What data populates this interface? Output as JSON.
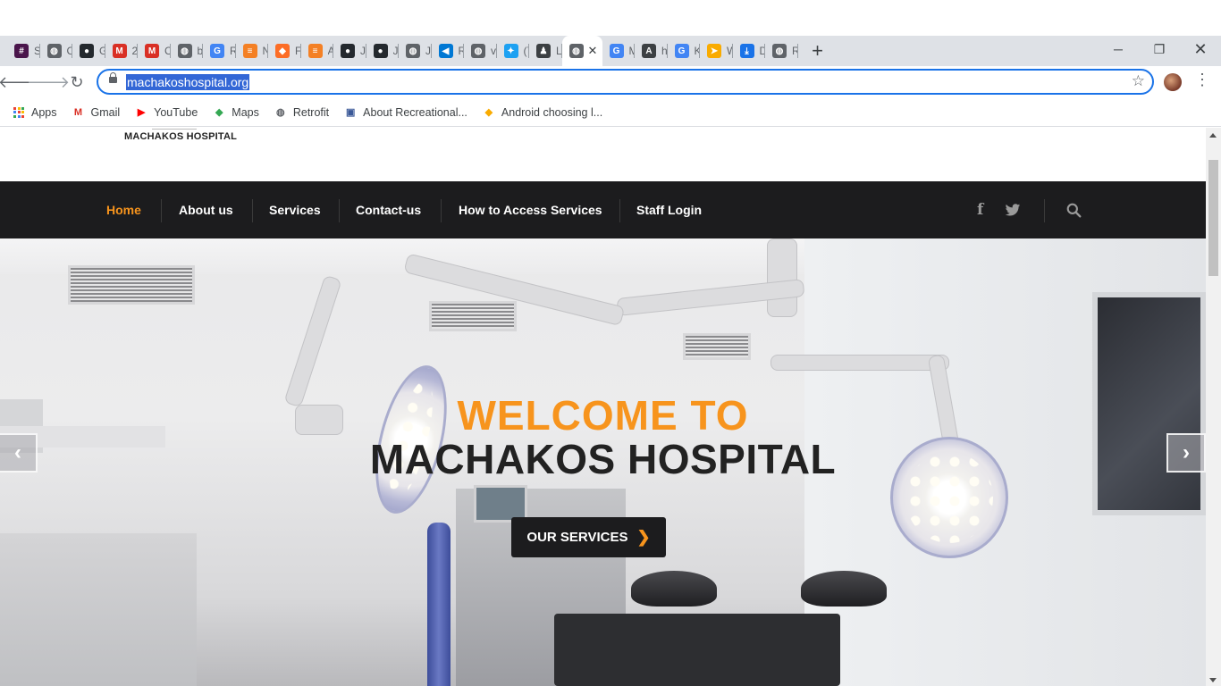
{
  "browser": {
    "tabs": [
      {
        "label": "Sl",
        "color": "#4a154b",
        "glyph": "#"
      },
      {
        "label": "C",
        "color": "#5f6368",
        "glyph": "◍"
      },
      {
        "label": "G",
        "color": "#24292e",
        "glyph": "●"
      },
      {
        "label": "2",
        "color": "#d93025",
        "glyph": "M"
      },
      {
        "label": "C",
        "color": "#d93025",
        "glyph": "M"
      },
      {
        "label": "bl",
        "color": "#5f6368",
        "glyph": "◍"
      },
      {
        "label": "R",
        "color": "#4285f4",
        "glyph": "G"
      },
      {
        "label": "N",
        "color": "#f48024",
        "glyph": "≡"
      },
      {
        "label": "Fi",
        "color": "#fc6d26",
        "glyph": "◆"
      },
      {
        "label": "A",
        "color": "#f48024",
        "glyph": "≡"
      },
      {
        "label": "Ja",
        "color": "#24292e",
        "glyph": "●"
      },
      {
        "label": "Ja",
        "color": "#24292e",
        "glyph": "●"
      },
      {
        "label": "Ja",
        "color": "#5f6368",
        "glyph": "◍"
      },
      {
        "label": "R",
        "color": "#0078d4",
        "glyph": "◀"
      },
      {
        "label": "vi",
        "color": "#5f6368",
        "glyph": "◍"
      },
      {
        "label": "(7",
        "color": "#1da1f2",
        "glyph": "✦"
      },
      {
        "label": "Le",
        "color": "#3c4043",
        "glyph": "♟"
      },
      {
        "label": "",
        "color": "#5f6368",
        "glyph": "◍",
        "active": true
      },
      {
        "label": "M",
        "color": "#4285f4",
        "glyph": "G"
      },
      {
        "label": "h",
        "color": "#3c4043",
        "glyph": "A"
      },
      {
        "label": "K",
        "color": "#4285f4",
        "glyph": "G"
      },
      {
        "label": "W",
        "color": "#f9ab00",
        "glyph": "➤"
      },
      {
        "label": "D",
        "color": "#1a73e8",
        "glyph": "⤓"
      },
      {
        "label": "R",
        "color": "#5f6368",
        "glyph": "◍"
      }
    ],
    "new_tab": "+",
    "url": "machakoshospital.org",
    "bookmarks": [
      {
        "label": "Apps",
        "icon": "apps-grid-icon"
      },
      {
        "label": "Gmail",
        "icon": "gmail-icon",
        "glyph": "M",
        "color": "#d93025"
      },
      {
        "label": "YouTube",
        "icon": "youtube-icon",
        "glyph": "▶",
        "color": "#ff0000"
      },
      {
        "label": "Maps",
        "icon": "maps-icon",
        "glyph": "◆",
        "color": "#34a853"
      },
      {
        "label": "Retrofit",
        "icon": "globe-icon",
        "glyph": "◍",
        "color": "#5f6368"
      },
      {
        "label": "About Recreational...",
        "icon": "site-icon",
        "glyph": "▣",
        "color": "#3b5998"
      },
      {
        "label": "Android choosing l...",
        "icon": "site-icon",
        "glyph": "◆",
        "color": "#f9ab00"
      }
    ]
  },
  "site": {
    "logo_text": "MACHAKOS HOSPITAL",
    "nav": [
      {
        "label": "Home",
        "active": true
      },
      {
        "label": "About us"
      },
      {
        "label": "Services"
      },
      {
        "label": "Contact-us"
      },
      {
        "label": "How to Access Services"
      },
      {
        "label": "Staff Login"
      }
    ],
    "hero": {
      "line1": "WELCOME TO",
      "line2": "MACHAKOS HOSPITAL",
      "cta": "OUR SERVICES"
    },
    "colors": {
      "accent": "#f7941d",
      "nav_bg": "#1c1c1e",
      "text_dark": "#222222"
    }
  }
}
